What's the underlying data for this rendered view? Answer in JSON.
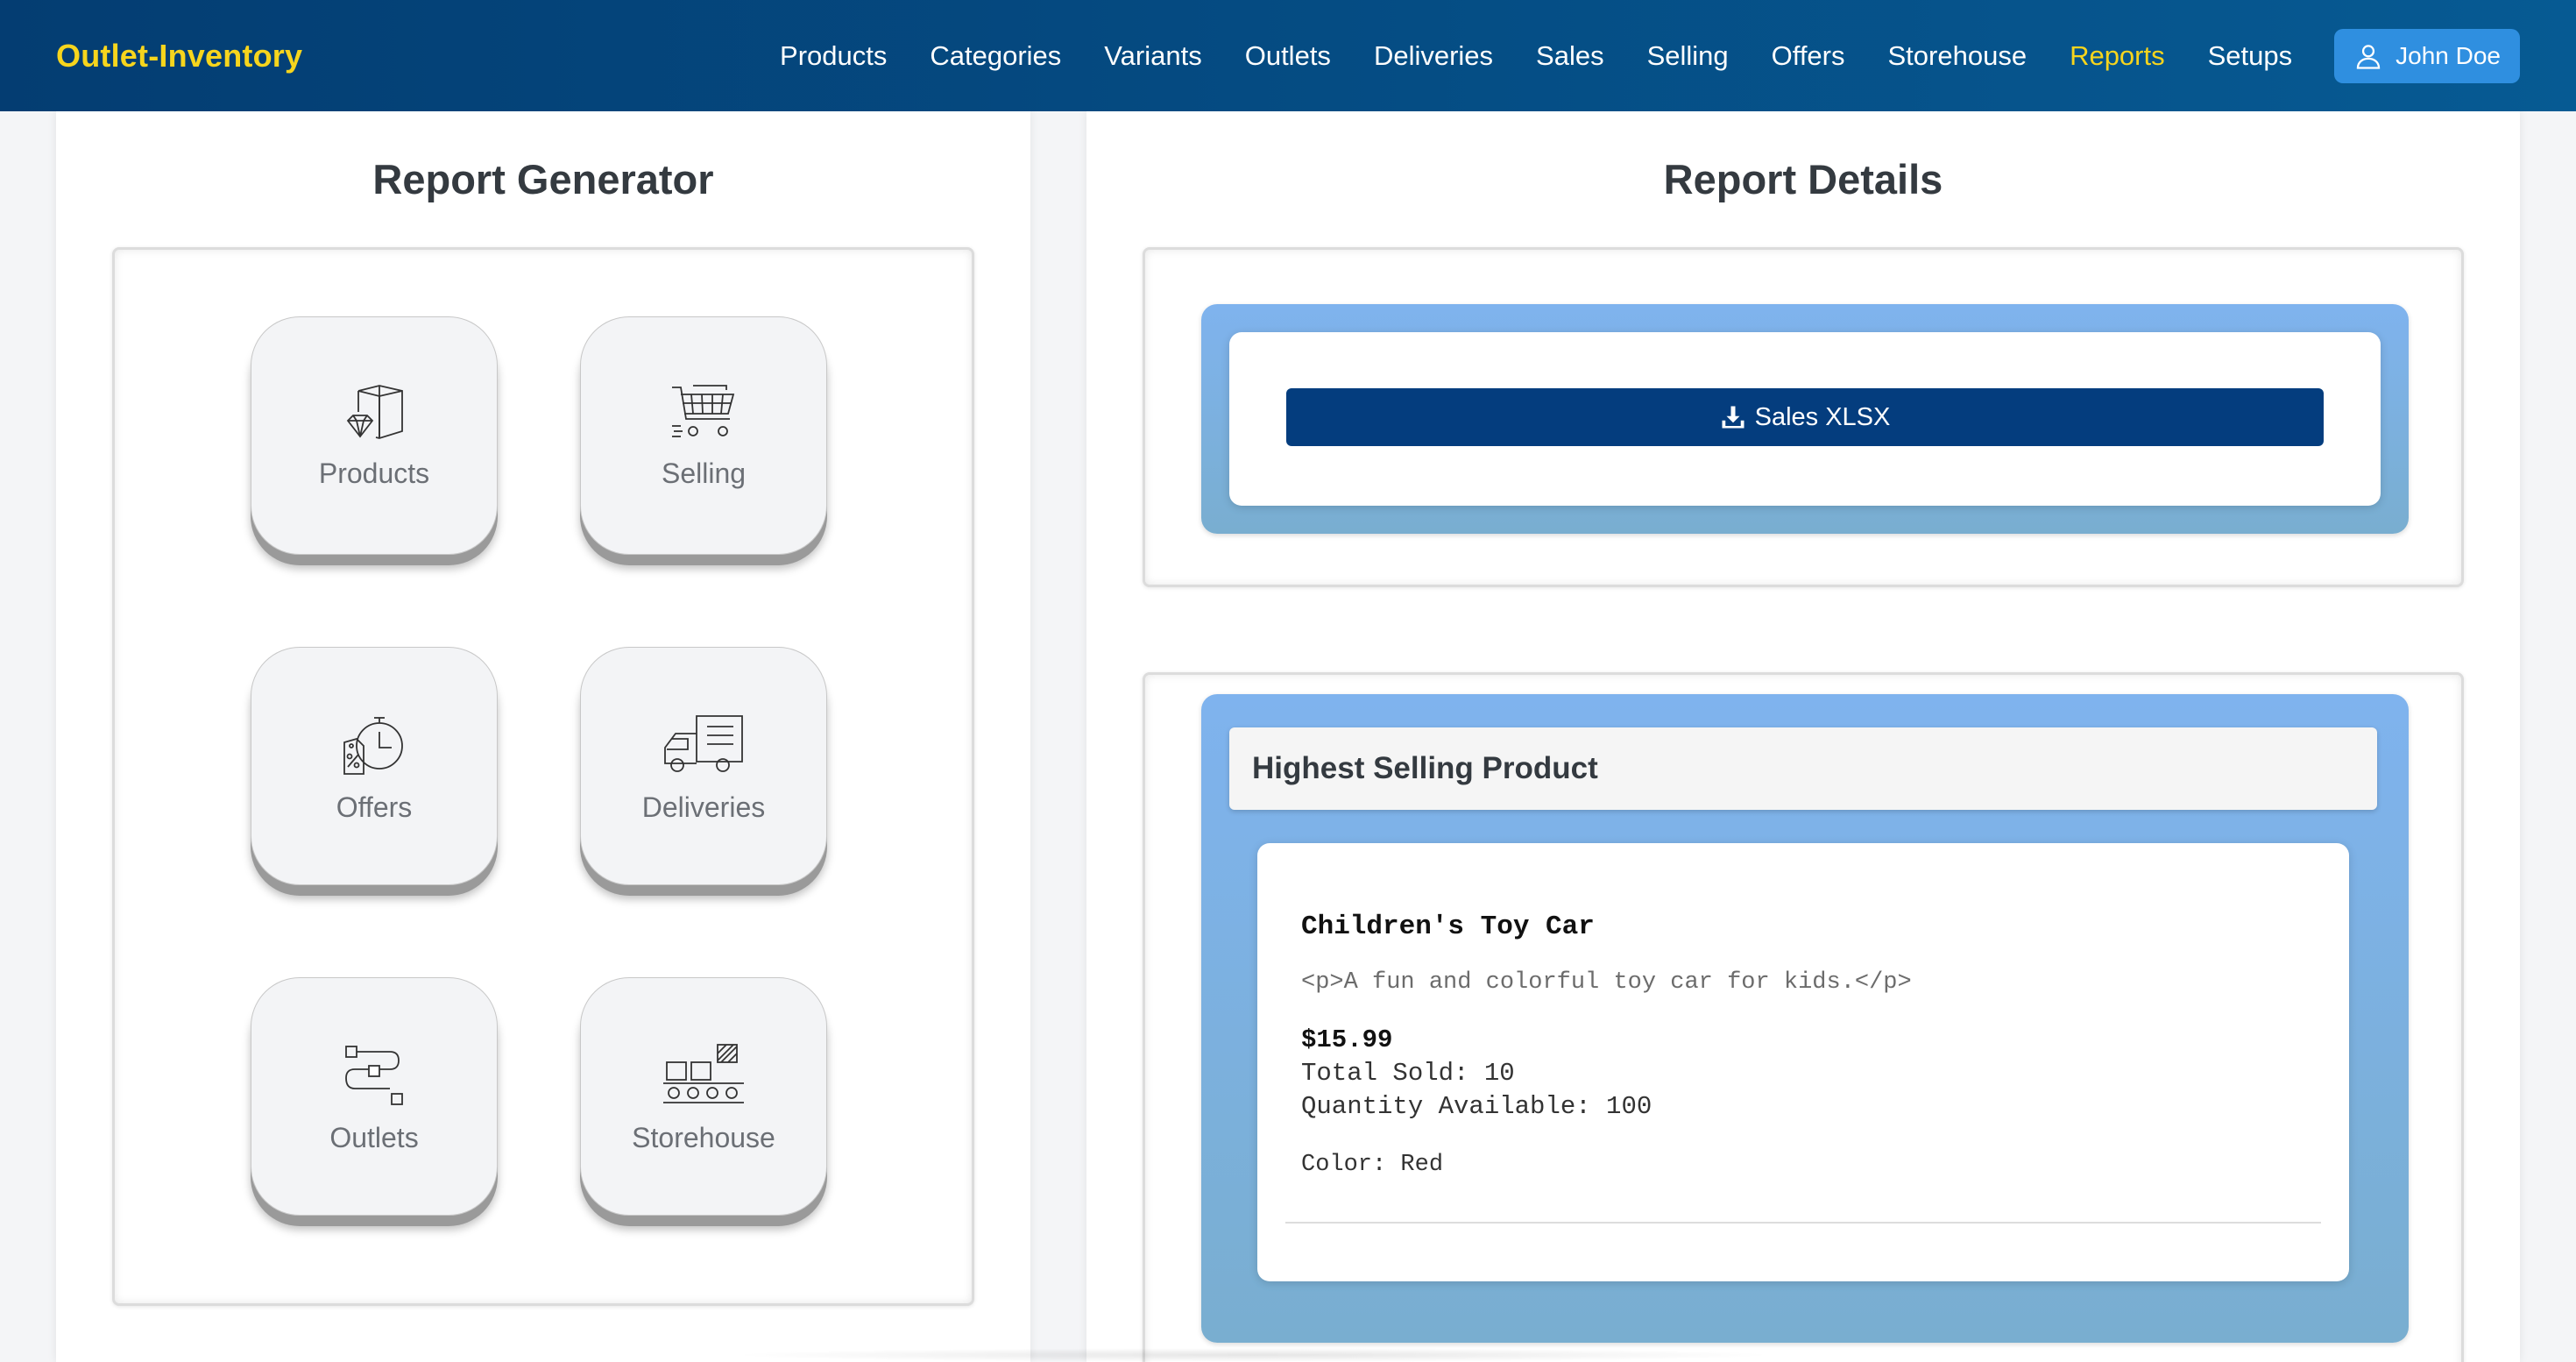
{
  "brand": "Outlet-Inventory",
  "nav": {
    "items": [
      {
        "label": "Products"
      },
      {
        "label": "Categories"
      },
      {
        "label": "Variants"
      },
      {
        "label": "Outlets"
      },
      {
        "label": "Deliveries"
      },
      {
        "label": "Sales"
      },
      {
        "label": "Selling"
      },
      {
        "label": "Offers"
      },
      {
        "label": "Storehouse"
      },
      {
        "label": "Reports",
        "active": true
      },
      {
        "label": "Setups"
      }
    ],
    "user": {
      "name": "John Doe",
      "icon": "user-icon"
    }
  },
  "colors": {
    "navbar": "#043d72",
    "accent": "#f7d51d",
    "user_button": "#2f8fe0",
    "download_button": "#043d7e",
    "card_blue": "#7fb3ee"
  },
  "generator": {
    "title": "Report Generator",
    "tiles": [
      {
        "label": "Products",
        "icon": "product-box-icon"
      },
      {
        "label": "Selling",
        "icon": "shopping-cart-icon"
      },
      {
        "label": "Offers",
        "icon": "offer-timer-icon"
      },
      {
        "label": "Deliveries",
        "icon": "delivery-truck-icon"
      },
      {
        "label": "Outlets",
        "icon": "route-icon"
      },
      {
        "label": "Storehouse",
        "icon": "conveyor-icon"
      }
    ]
  },
  "details": {
    "title": "Report Details",
    "download_label": "Sales XLSX",
    "highest": {
      "title": "Highest Selling Product",
      "product_name": "Children's Toy Car",
      "description": "<p>A fun and colorful toy car for kids.</p>",
      "price": "$15.99",
      "total_sold": "Total Sold: 10",
      "quantity": "Quantity Available: 100",
      "color": "Color: Red"
    }
  }
}
